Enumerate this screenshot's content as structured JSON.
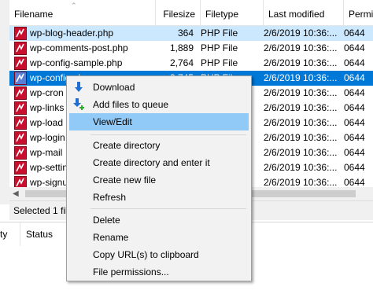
{
  "file_list": {
    "columns": {
      "filename": "Filename",
      "filesize": "Filesize",
      "filetype": "Filetype",
      "last_modified": "Last modified",
      "permissions": "Permiss"
    },
    "rows": [
      {
        "name": "wp-blog-header.php",
        "size": "364",
        "type": "PHP File",
        "modified": "2/6/2019 10:36:...",
        "perm": "0644"
      },
      {
        "name": "wp-comments-post.php",
        "size": "1,889",
        "type": "PHP File",
        "modified": "2/6/2019 10:36:...",
        "perm": "0644"
      },
      {
        "name": "wp-config-sample.php",
        "size": "2,764",
        "type": "PHP File",
        "modified": "2/6/2019 10:36:...",
        "perm": "0644"
      },
      {
        "name": "wp-config.php",
        "size": "2,745",
        "type": "PHP File",
        "modified": "2/6/2019 10:36:...",
        "perm": "0644"
      },
      {
        "name": "wp-cron",
        "size": "",
        "type": "",
        "modified": "2/6/2019 10:36:...",
        "perm": "0644"
      },
      {
        "name": "wp-links",
        "size": "",
        "type": "",
        "modified": "2/6/2019 10:36:...",
        "perm": "0644"
      },
      {
        "name": "wp-load",
        "size": "",
        "type": "",
        "modified": "2/6/2019 10:36:...",
        "perm": "0644"
      },
      {
        "name": "wp-login",
        "size": "",
        "type": "",
        "modified": "2/6/2019 10:36:...",
        "perm": "0644"
      },
      {
        "name": "wp-mail",
        "size": "",
        "type": "",
        "modified": "2/6/2019 10:36:...",
        "perm": "0644"
      },
      {
        "name": "wp-settin",
        "size": "",
        "type": "",
        "modified": "2/6/2019 10:36:...",
        "perm": "0644"
      },
      {
        "name": "wp-signu",
        "size": "",
        "type": "",
        "modified": "2/6/2019 10:36:...",
        "perm": "0644"
      }
    ]
  },
  "statusbar": {
    "text": "Selected 1 fil"
  },
  "queue": {
    "columns": {
      "first": "ty",
      "status": "Status"
    }
  },
  "context_menu": {
    "items": [
      {
        "label": "Download",
        "icon": "download-arrow-icon"
      },
      {
        "label": "Add files to queue",
        "icon": "add-to-queue-icon"
      },
      {
        "label": "View/Edit"
      },
      {
        "label": "Create directory"
      },
      {
        "label": "Create directory and enter it"
      },
      {
        "label": "Create new file"
      },
      {
        "label": "Refresh"
      },
      {
        "label": "Delete"
      },
      {
        "label": "Rename"
      },
      {
        "label": "Copy URL(s) to clipboard"
      },
      {
        "label": "File permissions..."
      }
    ]
  },
  "colors": {
    "selection": "#0078d7",
    "hover_highlight": "#91c9f7",
    "php_icon": "#c8102e"
  }
}
